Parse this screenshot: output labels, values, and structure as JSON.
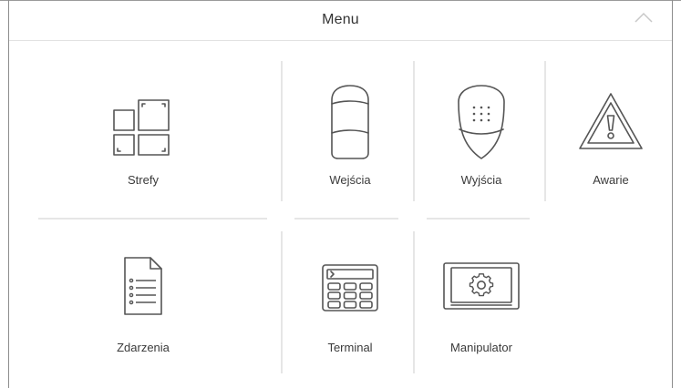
{
  "header": {
    "title": "Menu",
    "collapse_icon": "chevron-up-icon"
  },
  "tiles": [
    {
      "label": "Strefy",
      "icon": "partitions-icon"
    },
    {
      "label": "Wejścia",
      "icon": "motion-detector-icon"
    },
    {
      "label": "Wyjścia",
      "icon": "siren-icon"
    },
    {
      "label": "Awarie",
      "icon": "warning-triangle-icon"
    },
    {
      "label": "Zdarzenia",
      "icon": "document-list-icon"
    },
    {
      "label": "Terminal",
      "icon": "keypad-terminal-icon"
    },
    {
      "label": "Manipulator",
      "icon": "settings-display-icon"
    }
  ],
  "colors": {
    "line": "#e6e6e6",
    "icon": "#555555",
    "frame": "#8d8d8d"
  }
}
